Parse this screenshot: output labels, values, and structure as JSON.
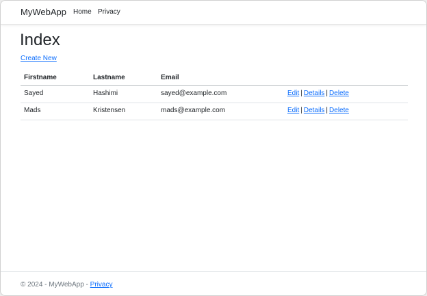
{
  "navbar": {
    "brand": "MyWebApp",
    "links": [
      "Home",
      "Privacy"
    ]
  },
  "page": {
    "title": "Index",
    "create_link": "Create New"
  },
  "table": {
    "headers": [
      "Firstname",
      "Lastname",
      "Email",
      ""
    ],
    "rows": [
      {
        "firstname": "Sayed",
        "lastname": "Hashimi",
        "email": "sayed@example.com"
      },
      {
        "firstname": "Mads",
        "lastname": "Kristensen",
        "email": "mads@example.com"
      }
    ],
    "actions": {
      "edit": "Edit",
      "details": "Details",
      "delete": "Delete",
      "separator": "|"
    }
  },
  "footer": {
    "text": "© 2024 - MyWebApp - ",
    "link": "Privacy"
  },
  "colors": {
    "link": "#0d6efd",
    "text": "#212529",
    "muted": "#6c757d"
  }
}
